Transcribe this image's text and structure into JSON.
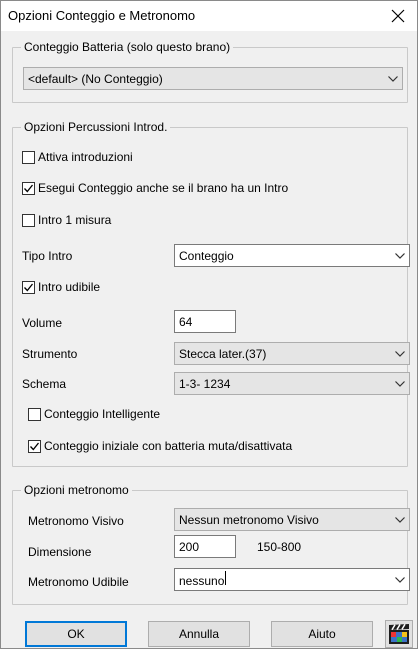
{
  "window": {
    "title": "Opzioni Conteggio e Metronomo"
  },
  "drum_count": {
    "legend": "Conteggio Batteria (solo questo brano)",
    "value": "<default> (No Conteggio)"
  },
  "intro_options": {
    "legend": "Opzioni Percussioni Introd.",
    "enable_intro": {
      "label": "Attiva introduzioni",
      "checked": false
    },
    "count_even_if_intro": {
      "label": "Esegui Conteggio anche se il brano ha un Intro",
      "checked": true
    },
    "intro_one_bar": {
      "label": "Intro 1 misura",
      "checked": false
    },
    "intro_type": {
      "label": "Tipo Intro",
      "value": "Conteggio"
    },
    "intro_audible": {
      "label": "Intro udibile",
      "checked": true
    },
    "volume": {
      "label": "Volume",
      "value": "64"
    },
    "instrument": {
      "label": "Strumento",
      "value": "Stecca later.(37)"
    },
    "pattern": {
      "label": "Schema",
      "value": "1-3- 1234"
    },
    "smart_count": {
      "label": "Conteggio Intelligente",
      "checked": false
    },
    "count_muted_drums": {
      "label": "Conteggio iniziale con batteria muta/disattivata",
      "checked": true
    }
  },
  "metronome_options": {
    "legend": "Opzioni metronomo",
    "visual": {
      "label": "Metronomo Visivo",
      "value": "Nessun metronomo Visivo"
    },
    "size": {
      "label": "Dimensione",
      "value": "200",
      "range": "150-800"
    },
    "audible": {
      "label": "Metronomo Udibile",
      "value": "nessuno"
    }
  },
  "buttons": {
    "ok": "OK",
    "cancel": "Annulla",
    "help": "Aiuto"
  }
}
